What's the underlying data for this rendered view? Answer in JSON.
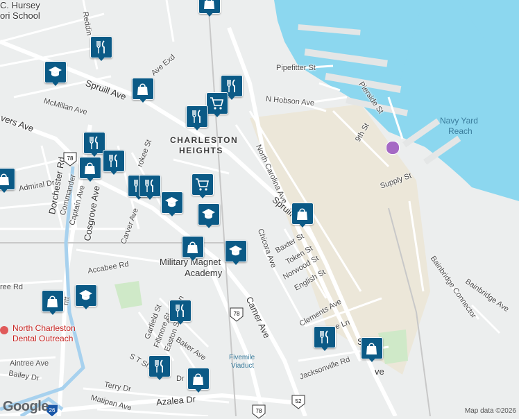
{
  "map": {
    "labels": {
      "school_top": "C. Hursey",
      "school_top2": "ori School",
      "reddin": "Reddin",
      "pipefitter": "Pipefitter St",
      "nhobson": "N Hobson Ave",
      "pierside": "Pierside St",
      "ninth": "9th St",
      "navy1": "Navy Yard",
      "navy2": "Reach",
      "supply": "Supply St",
      "spruill1": "Spruill Ave",
      "mcmillan": "McMillan Ave",
      "rivers": "vers Ave",
      "charleston1": "CHARLESTON",
      "charleston2": "HEIGHTS",
      "dorchester": "Dorchester Rd",
      "admiral": "Admiral Dr",
      "commander": "Commander",
      "captain": "Captain Ave",
      "cosgrove": "Cosgrove Ave",
      "carver": "Carver Ave",
      "cherokee": "rokee St",
      "ncarolina": "North Carolina Ave",
      "spruill2": "Spruill",
      "chicora": "Chicora Ave",
      "baxter": "Baxter St",
      "token": "Token St",
      "norwood": "Norwood St",
      "english": "English St",
      "accabee": "Accabee Rd",
      "military1": "Military Magnet",
      "military2": "Academy",
      "rivers2": "ree Rd",
      "rivers3": "ritt",
      "camer": "Camer Ave",
      "bainbridge_conn": "Bainbridge Connector",
      "bainbridge_ave": "Bainbridge Ave",
      "clements": "Clements Ave",
      "lane": "e Ln",
      "jacksonville": "Jacksonville Rd",
      "stave": "S",
      "stave2": "ve",
      "appleton": "Appleton",
      "garfield": "Garfield St",
      "fillmore": "Fillmore St",
      "easton": "Easton St",
      "baker": "Baker Ave",
      "st_s": "S T Sh",
      "st_dr": "Dr",
      "fivemile1": "Fivemile",
      "fivemile2": "Viaduct",
      "aintree": "Aintree Ave",
      "bailey": "Bailey Dr",
      "terry": "Terry Dr",
      "azalea": "Azalea Dr",
      "matipan": "Matipan Ave",
      "dental1": "North Charleston",
      "dental2": "Dental Outreach",
      "ave_exd": "Ave Exd"
    },
    "shields": {
      "us78a": "78",
      "us78b": "78",
      "us78c": "78",
      "us52": "52",
      "i26": "26"
    },
    "pins": [
      {
        "type": "shopping-bag-icon"
      },
      {
        "type": "restaurant-icon"
      },
      {
        "type": "school-icon"
      },
      {
        "type": "restaurant-icon"
      },
      {
        "type": "shopping-bag-icon"
      },
      {
        "type": "grocery-cart-icon"
      },
      {
        "type": "restaurant-icon"
      },
      {
        "type": "restaurant-icon"
      },
      {
        "type": "shopping-bag-icon"
      },
      {
        "type": "restaurant-icon"
      },
      {
        "type": "restaurant-icon"
      },
      {
        "type": "grocery-cart-icon"
      },
      {
        "type": "restaurant-icon"
      },
      {
        "type": "school-icon"
      },
      {
        "type": "shopping-bag-icon"
      },
      {
        "type": "school-icon"
      },
      {
        "type": "shopping-bag-icon"
      },
      {
        "type": "shopping-bag-icon"
      },
      {
        "type": "school-icon"
      },
      {
        "type": "shopping-bag-icon"
      },
      {
        "type": "school-icon"
      },
      {
        "type": "restaurant-icon"
      },
      {
        "type": "restaurant-icon"
      },
      {
        "type": "shopping-bag-icon"
      },
      {
        "type": "restaurant-icon"
      },
      {
        "type": "shopping-bag-icon"
      }
    ],
    "colors": {
      "water": "#8cd7ef",
      "land": "#eceeee",
      "road": "#ffffff",
      "pin": "#0b5a86",
      "park": "#cfe9c8"
    }
  },
  "footer": {
    "google": "Google",
    "copyright": "Map data ©2026"
  }
}
